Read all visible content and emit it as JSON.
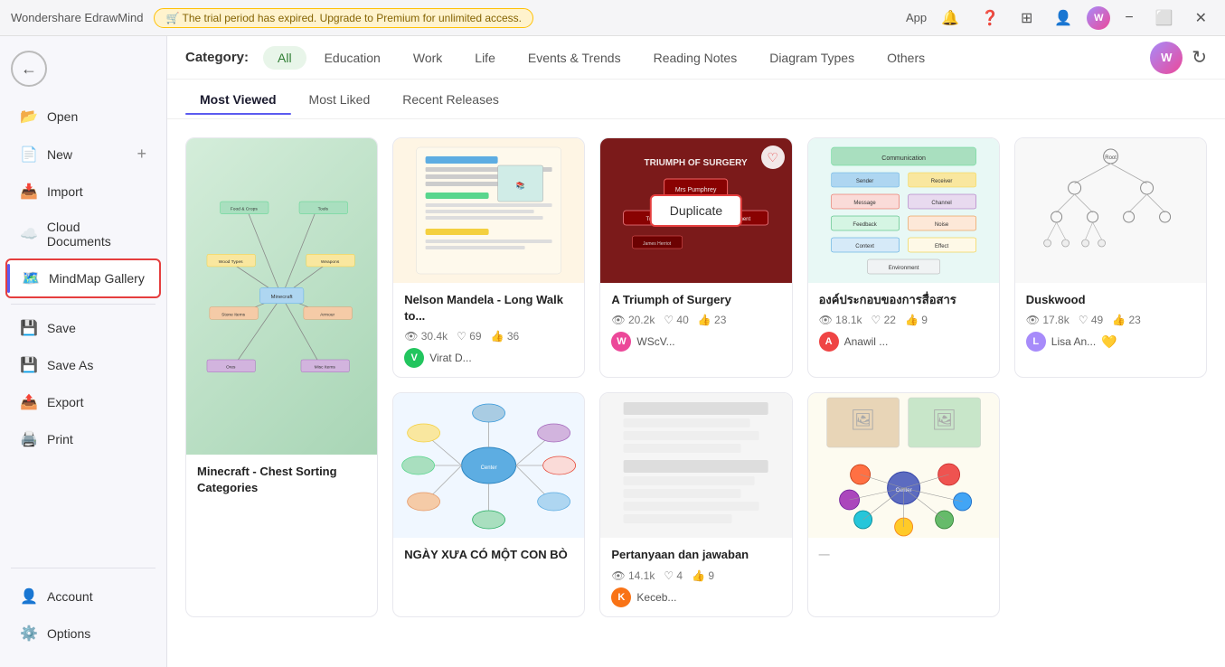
{
  "app": {
    "title": "Wondershare EdrawMind",
    "upgrade_text": "🛒 The trial period has expired. Upgrade to Premium for unlimited access.",
    "app_label": "App"
  },
  "titlebar": {
    "minimize": "−",
    "maximize": "⬜",
    "close": "✕"
  },
  "sidebar": {
    "back_label": "←",
    "items": [
      {
        "id": "open",
        "label": "Open",
        "icon": "📂"
      },
      {
        "id": "new",
        "label": "New",
        "icon": "📄"
      },
      {
        "id": "import",
        "label": "Import",
        "icon": "📥"
      },
      {
        "id": "cloud",
        "label": "Cloud Documents",
        "icon": "☁️"
      },
      {
        "id": "gallery",
        "label": "MindMap Gallery",
        "icon": "🗺️",
        "active": true
      },
      {
        "id": "save",
        "label": "Save",
        "icon": "💾"
      },
      {
        "id": "saveas",
        "label": "Save As",
        "icon": "💾"
      },
      {
        "id": "export",
        "label": "Export",
        "icon": "📤"
      },
      {
        "id": "print",
        "label": "Print",
        "icon": "🖨️"
      }
    ],
    "bottom_items": [
      {
        "id": "account",
        "label": "Account",
        "icon": "👤"
      },
      {
        "id": "options",
        "label": "Options",
        "icon": "⚙️"
      }
    ]
  },
  "categories": {
    "label": "Category:",
    "items": [
      {
        "id": "all",
        "label": "All",
        "active": true
      },
      {
        "id": "education",
        "label": "Education"
      },
      {
        "id": "work",
        "label": "Work"
      },
      {
        "id": "life",
        "label": "Life"
      },
      {
        "id": "events",
        "label": "Events & Trends"
      },
      {
        "id": "reading",
        "label": "Reading Notes"
      },
      {
        "id": "diagram",
        "label": "Diagram Types"
      },
      {
        "id": "others",
        "label": "Others"
      }
    ]
  },
  "tabs": [
    {
      "id": "most_viewed",
      "label": "Most Viewed",
      "active": true
    },
    {
      "id": "most_liked",
      "label": "Most Liked"
    },
    {
      "id": "recent",
      "label": "Recent Releases"
    }
  ],
  "cards": [
    {
      "id": "minecraft",
      "title": "Minecraft - Chest Sorting Categories",
      "views": "",
      "likes": "",
      "comments": "",
      "author": "",
      "author_color": "#888",
      "thumb_type": "green-mindmap",
      "large": true
    },
    {
      "id": "nelson",
      "title": "Nelson Mandela - Long Walk to...",
      "views": "30.4k",
      "likes": "69",
      "comments": "36",
      "author": "Virat D...",
      "author_color": "#22c55e",
      "author_initial": "V",
      "thumb_type": "beige-text"
    },
    {
      "id": "surgery",
      "title": "A Triumph of Surgery",
      "views": "20.2k",
      "likes": "40",
      "comments": "23",
      "author": "WScV...",
      "author_color": "#ec4899",
      "author_initial": "W",
      "thumb_type": "dark-red",
      "has_heart": true,
      "has_duplicate": true
    },
    {
      "id": "org",
      "title": "องค์ประกอบของการสื่อสาร",
      "views": "18.1k",
      "likes": "22",
      "comments": "9",
      "author": "Anawil ...",
      "author_color": "#ef4444",
      "author_initial": "A",
      "thumb_type": "teal-cards"
    },
    {
      "id": "duskwood",
      "title": "Duskwood",
      "views": "17.8k",
      "likes": "49",
      "comments": "23",
      "author": "Lisa An...",
      "author_color": "#a78bfa",
      "author_initial": "L",
      "thumb_type": "white-tree",
      "has_gold": true
    },
    {
      "id": "ngay",
      "title": "NGÀY XƯA CÓ MỘT CON BÒ",
      "views": "",
      "likes": "",
      "comments": "",
      "author": "",
      "author_color": "#888",
      "thumb_type": "colorful-map"
    },
    {
      "id": "pertanyaan",
      "title": "Pertanyaan dan jawaban",
      "views": "14.1k",
      "likes": "4",
      "comments": "9",
      "author": "Keceb...",
      "author_color": "#f97316",
      "author_initial": "K",
      "thumb_type": "gray-text"
    },
    {
      "id": "colorful",
      "title": "",
      "views": "",
      "likes": "",
      "comments": "",
      "author": "",
      "thumb_type": "colorful-circles"
    }
  ]
}
